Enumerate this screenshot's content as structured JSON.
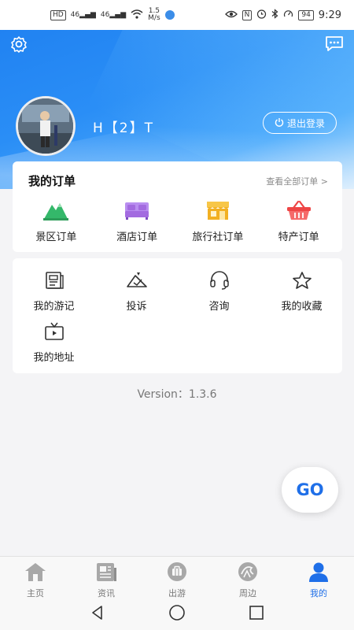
{
  "statusbar": {
    "network1": "HD",
    "signal1": "46",
    "signal2": "46",
    "speed_value": "1.5",
    "speed_unit": "M/s",
    "nfc": "N",
    "battery": "94",
    "time": "9:29"
  },
  "header": {
    "username": "H【2】T",
    "logout_label": "退出登录"
  },
  "orders": {
    "title": "我的订单",
    "view_all": "查看全部订单 >",
    "items": [
      {
        "label": "景区订单",
        "icon": "mountain-icon",
        "color": "#34b86a"
      },
      {
        "label": "酒店订单",
        "icon": "bed-icon",
        "color": "#a36be0"
      },
      {
        "label": "旅行社订单",
        "icon": "shop-icon",
        "color": "#f2b022"
      },
      {
        "label": "特产订单",
        "icon": "basket-icon",
        "color": "#ee4545"
      }
    ]
  },
  "tools": {
    "items": [
      {
        "label": "我的游记",
        "icon": "notes-icon"
      },
      {
        "label": "投诉",
        "icon": "complaint-icon"
      },
      {
        "label": "咨询",
        "icon": "headset-icon"
      },
      {
        "label": "我的收藏",
        "icon": "star-icon"
      },
      {
        "label": "我的地址",
        "icon": "tv-icon"
      }
    ]
  },
  "version": "Version：1.3.6",
  "go_label": "GO",
  "tabs": [
    {
      "label": "主页",
      "icon": "home-icon",
      "active": false
    },
    {
      "label": "资讯",
      "icon": "news-icon",
      "active": false
    },
    {
      "label": "出游",
      "icon": "travel-icon",
      "active": false
    },
    {
      "label": "周边",
      "icon": "nearby-icon",
      "active": false
    },
    {
      "label": "我的",
      "icon": "user-icon",
      "active": true
    }
  ],
  "colors": {
    "accent": "#1f6fe8",
    "header_blue": "#1e7ff0"
  }
}
